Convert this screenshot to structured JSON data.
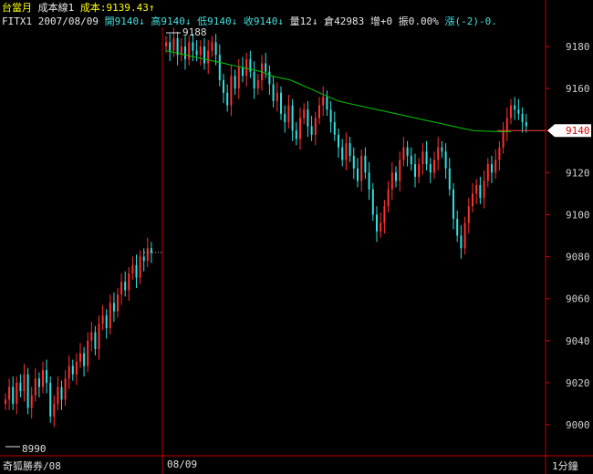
{
  "header": {
    "title": "台當月",
    "cost_line_label": "成本線1",
    "cost_label": "成本:9139.43↑",
    "symbol": "FITX1",
    "date": "2007/08/09",
    "open": "開9140↓",
    "high": "高9140↓",
    "low": "低9140↓",
    "close": "收9140↓",
    "volume": "量12↓",
    "open_interest": "倉42983",
    "increase": "增+0",
    "amplitude": "振0.00%",
    "change": "漲(-2)-0."
  },
  "footer": {
    "tab_label": "奇狐勝券/08",
    "date_label": "08/09",
    "interval_label": "1分鐘"
  },
  "colors": {
    "up": "#ff3030",
    "down": "#30e0e0",
    "cost_line": "#00c800",
    "axis": "#c00000",
    "price_tag_bg": "#ffffff",
    "price_tag_text": "#e00000"
  },
  "chart_data": {
    "type": "candlestick",
    "y_ticks": [
      "9180",
      "9160",
      "9140",
      "9120",
      "9100",
      "9080",
      "9060",
      "9040",
      "9020",
      "9000"
    ],
    "ylim": [
      8990,
      9190
    ],
    "current_price": "9140",
    "high_mark": "9188",
    "low_mark": "8990",
    "day1_close": [
      9012,
      9018,
      9010,
      9020,
      9016,
      9024,
      9008,
      9014,
      9022,
      9018,
      9026,
      9020,
      9004,
      9010,
      9018,
      9012,
      9022,
      9028,
      9024,
      9030,
      9034,
      9028,
      9040,
      9044,
      9036,
      9048,
      9052,
      9046,
      9058,
      9054,
      9062,
      9068,
      9064,
      9072,
      9076,
      9070,
      9080,
      9078,
      9084,
      9082
    ],
    "day2_close": [
      9182,
      9178,
      9184,
      9176,
      9180,
      9174,
      9182,
      9178,
      9176,
      9180,
      9172,
      9178,
      9182,
      9176,
      9164,
      9158,
      9152,
      9166,
      9160,
      9170,
      9166,
      9174,
      9168,
      9160,
      9164,
      9172,
      9168,
      9162,
      9154,
      9158,
      9148,
      9144,
      9152,
      9140,
      9136,
      9146,
      9150,
      9142,
      9138,
      9146,
      9152,
      9156,
      9150,
      9144,
      9138,
      9132,
      9126,
      9134,
      9128,
      9122,
      9116,
      9128,
      9120,
      9112,
      9100,
      9092,
      9096,
      9104,
      9112,
      9120,
      9116,
      9126,
      9132,
      9128,
      9124,
      9118,
      9124,
      9130,
      9124,
      9120,
      9126,
      9132,
      9130,
      9122,
      9112,
      9098,
      9090,
      9084,
      9096,
      9104,
      9110,
      9114,
      9108,
      9116,
      9124,
      9120,
      9126,
      9132,
      9140,
      9146,
      9152,
      9150,
      9148,
      9144,
      9142
    ],
    "cost_line": [
      9178,
      9177,
      9176,
      9175,
      9174,
      9173,
      9172,
      9171,
      9170,
      9169,
      9168,
      9166,
      9165,
      9164,
      9162,
      9160,
      9158,
      9156,
      9154,
      9153,
      9152,
      9151,
      9150,
      9149,
      9148,
      9147,
      9146,
      9145,
      9144,
      9143,
      9142,
      9141,
      9140,
      9139.8,
      9139.6,
      9139.5,
      9139.43
    ]
  }
}
